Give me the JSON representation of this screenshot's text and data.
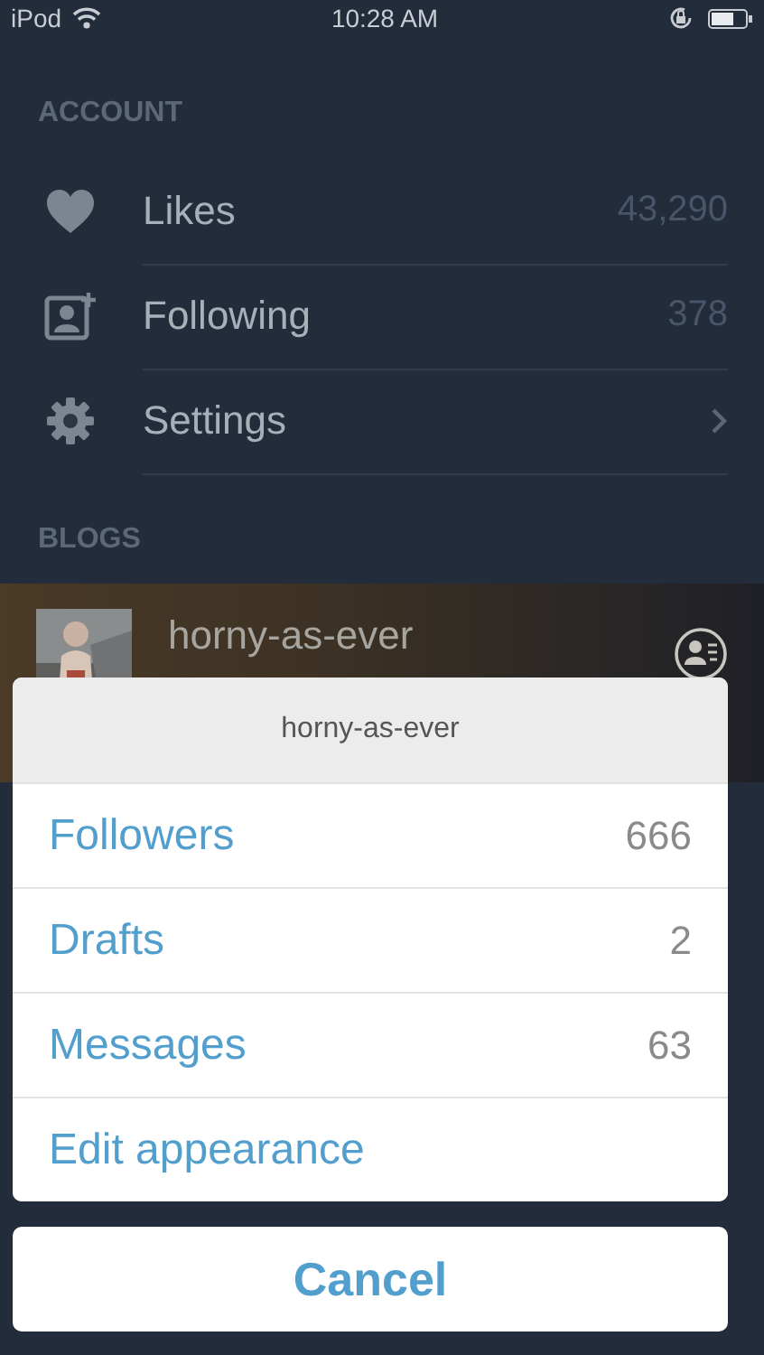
{
  "status_bar": {
    "carrier": "iPod",
    "time": "10:28 AM"
  },
  "account": {
    "header": "ACCOUNT",
    "items": [
      {
        "kind": "likes",
        "label": "Likes",
        "value": "43,290"
      },
      {
        "kind": "following",
        "label": "Following",
        "value": "378"
      },
      {
        "kind": "settings",
        "label": "Settings"
      }
    ]
  },
  "blogs": {
    "header": "BLOGS",
    "items": [
      {
        "name": "horny-as-ever"
      }
    ]
  },
  "action_sheet": {
    "title": "horny-as-ever",
    "items": [
      {
        "label": "Followers",
        "count": "666"
      },
      {
        "label": "Drafts",
        "count": "2"
      },
      {
        "label": "Messages",
        "count": "63"
      },
      {
        "label": "Edit appearance"
      }
    ],
    "cancel": "Cancel"
  }
}
